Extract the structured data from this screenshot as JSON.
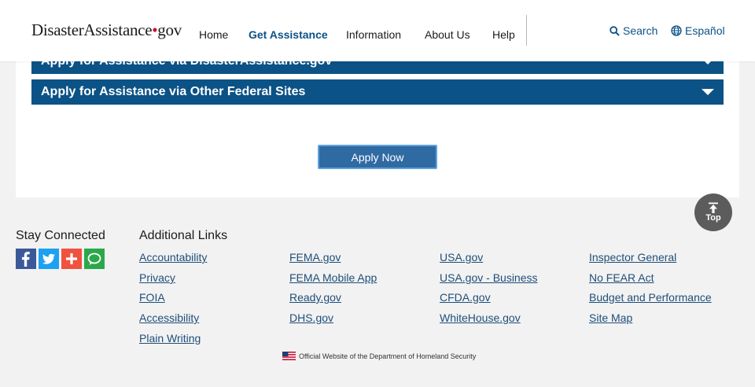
{
  "header": {
    "logo_main": "DisasterAssistance",
    "logo_dot": "•",
    "logo_gov": "gov",
    "nav": [
      "Home",
      "Get Assistance",
      "Information",
      "About Us",
      "Help"
    ],
    "active_nav": "Get Assistance",
    "search_label": "Search",
    "language_label": "Español"
  },
  "main": {
    "accordions": [
      "Apply for Assistance via DisasterAssistance.gov",
      "Apply for Assistance via Other Federal Sites"
    ],
    "apply_button": "Apply Now"
  },
  "back_to_top": "Top",
  "footer": {
    "stay_connected": "Stay Connected",
    "social_icons": [
      "facebook-icon",
      "twitter-icon",
      "addthis-icon",
      "chat-icon"
    ],
    "social_colors": [
      "#3b5998",
      "#1da1f2",
      "#f0523f",
      "#2ba84a"
    ],
    "additional_links_title": "Additional Links",
    "link_columns": [
      [
        "Accountability",
        "Privacy",
        "FOIA",
        "Accessibility",
        "Plain Writing"
      ],
      [
        "FEMA.gov",
        "FEMA Mobile App",
        "Ready.gov",
        "DHS.gov"
      ],
      [
        "USA.gov",
        "USA.gov - Business",
        "CFDA.gov",
        "WhiteHouse.gov"
      ],
      [
        "Inspector General",
        "No FEAR Act",
        "Budget and Performance",
        "Site Map"
      ]
    ],
    "official_text": "Official Website of the Department of Homeland Security"
  },
  "colors": {
    "accent": "#0b5286",
    "link": "#1f4e79",
    "button": "#2f6aa3"
  }
}
